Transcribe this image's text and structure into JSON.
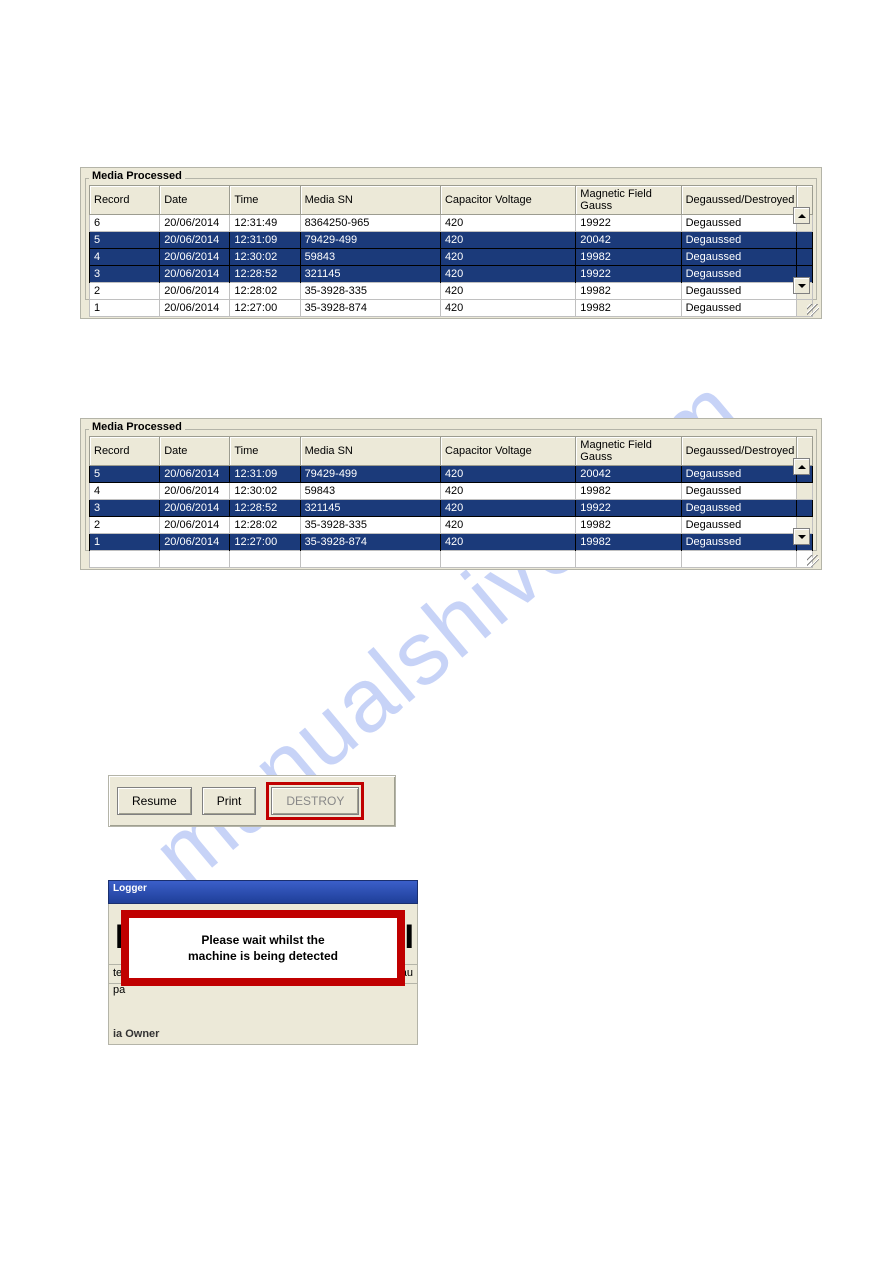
{
  "watermark_text": "manualshive.com",
  "columns": [
    {
      "key": "record",
      "label": "Record"
    },
    {
      "key": "date",
      "label": "Date"
    },
    {
      "key": "time",
      "label": "Time"
    },
    {
      "key": "media_sn",
      "label": "Media SN"
    },
    {
      "key": "capacitor_voltage",
      "label": "Capacitor Voltage"
    },
    {
      "key": "magnetic_field_gauss",
      "label": "Magnetic Field Gauss"
    },
    {
      "key": "degaussed_destroyed",
      "label": "Degaussed/Destroyed"
    }
  ],
  "panel_top": {
    "title": "Media Processed",
    "rows": [
      {
        "record": "6",
        "date": "20/06/2014",
        "time": "12:31:49",
        "media_sn": "8364250-965",
        "capacitor_voltage": "420",
        "magnetic_field_gauss": "19922",
        "degaussed_destroyed": "Degaussed",
        "selected": false
      },
      {
        "record": "5",
        "date": "20/06/2014",
        "time": "12:31:09",
        "media_sn": "79429-499",
        "capacitor_voltage": "420",
        "magnetic_field_gauss": "20042",
        "degaussed_destroyed": "Degaussed",
        "selected": true
      },
      {
        "record": "4",
        "date": "20/06/2014",
        "time": "12:30:02",
        "media_sn": "59843",
        "capacitor_voltage": "420",
        "magnetic_field_gauss": "19982",
        "degaussed_destroyed": "Degaussed",
        "selected": true
      },
      {
        "record": "3",
        "date": "20/06/2014",
        "time": "12:28:52",
        "media_sn": "321145",
        "capacitor_voltage": "420",
        "magnetic_field_gauss": "19922",
        "degaussed_destroyed": "Degaussed",
        "selected": true,
        "dotted": true
      },
      {
        "record": "2",
        "date": "20/06/2014",
        "time": "12:28:02",
        "media_sn": "35-3928-335",
        "capacitor_voltage": "420",
        "magnetic_field_gauss": "19982",
        "degaussed_destroyed": "Degaussed",
        "selected": false
      },
      {
        "record": "1",
        "date": "20/06/2014",
        "time": "12:27:00",
        "media_sn": "35-3928-874",
        "capacitor_voltage": "420",
        "magnetic_field_gauss": "19982",
        "degaussed_destroyed": "Degaussed",
        "selected": false
      }
    ]
  },
  "panel_bottom": {
    "title": "Media Processed",
    "rows": [
      {
        "record": "5",
        "date": "20/06/2014",
        "time": "12:31:09",
        "media_sn": "79429-499",
        "capacitor_voltage": "420",
        "magnetic_field_gauss": "20042",
        "degaussed_destroyed": "Degaussed",
        "selected": true
      },
      {
        "record": "4",
        "date": "20/06/2014",
        "time": "12:30:02",
        "media_sn": "59843",
        "capacitor_voltage": "420",
        "magnetic_field_gauss": "19982",
        "degaussed_destroyed": "Degaussed",
        "selected": false
      },
      {
        "record": "3",
        "date": "20/06/2014",
        "time": "12:28:52",
        "media_sn": "321145",
        "capacitor_voltage": "420",
        "magnetic_field_gauss": "19922",
        "degaussed_destroyed": "Degaussed",
        "selected": true
      },
      {
        "record": "2",
        "date": "20/06/2014",
        "time": "12:28:02",
        "media_sn": "35-3928-335",
        "capacitor_voltage": "420",
        "magnetic_field_gauss": "19982",
        "degaussed_destroyed": "Degaussed",
        "selected": false
      },
      {
        "record": "1",
        "date": "20/06/2014",
        "time": "12:27:00",
        "media_sn": "35-3928-874",
        "capacitor_voltage": "420",
        "magnetic_field_gauss": "19982",
        "degaussed_destroyed": "Degaussed",
        "selected": true,
        "dotted": true
      }
    ],
    "has_blank_row": true
  },
  "button_bar": {
    "resume_label": "Resume",
    "print_label": "Print",
    "destroy_label": "DESTROY"
  },
  "logger_snip": {
    "title_suffix": "Logger",
    "back_left": "E",
    "back_right": "INI",
    "back_row_left": "te",
    "back_row_left2": "pa",
    "back_row_right": "Degau",
    "owner_fragment": "ia Owner",
    "wait_line1": "Please wait whilst the",
    "wait_line2": "machine is being detected"
  }
}
